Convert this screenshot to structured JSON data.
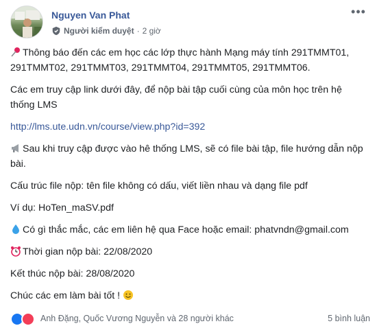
{
  "post": {
    "author": "Nguyen Van Phat",
    "role": "Người kiểm duyệt",
    "separator": "·",
    "time": "2 giờ",
    "paragraphs": [
      {
        "emoji": "pin-icon",
        "text": "Thông báo đến các em học các lớp thực hành Mạng máy tính 291TMMT01, 291TMMT02, 291TMMT03, 291TMMT04, 291TMMT05, 291TMMT06."
      },
      {
        "text": "Các em truy cập link dưới đây, để nộp bài tập cuối cùng của môn học trên hệ thống LMS"
      },
      {
        "link": "http://lms.ute.udn.vn/course/view.php?id=392"
      },
      {
        "emoji": "megaphone-icon",
        "text": "Sau khi truy cập được vào hê thống LMS, sẽ có file bài tập, file hướng dẫn nộp bài."
      },
      {
        "text": "Cấu trúc file nộp: tên file không có dấu, viết liền nhau và dạng file pdf"
      },
      {
        "text": "Ví dụ: HoTen_maSV.pdf"
      },
      {
        "emoji": "droplet-icon",
        "text": "Có gì thắc mắc, các em liên hệ qua Face hoặc email: phatvndn@gmail.com"
      },
      {
        "emoji": "alarm-clock-icon",
        "text": "Thời gian nộp bài: 22/08/2020"
      },
      {
        "text": "Kết thúc nộp bài: 28/08/2020"
      },
      {
        "text": "Chúc các em làm bài tốt !",
        "emoji_after": "smile-icon"
      }
    ]
  },
  "footer": {
    "reactions": [
      "like",
      "love"
    ],
    "names": "Anh Đặng, Quốc Vương Nguyễn và 28 người khác",
    "comments": "5 bình luận"
  },
  "colors": {
    "link": "#385898",
    "text": "#1c1e21",
    "meta": "#606770",
    "like": "#1877f2",
    "love": "#f33e58"
  }
}
